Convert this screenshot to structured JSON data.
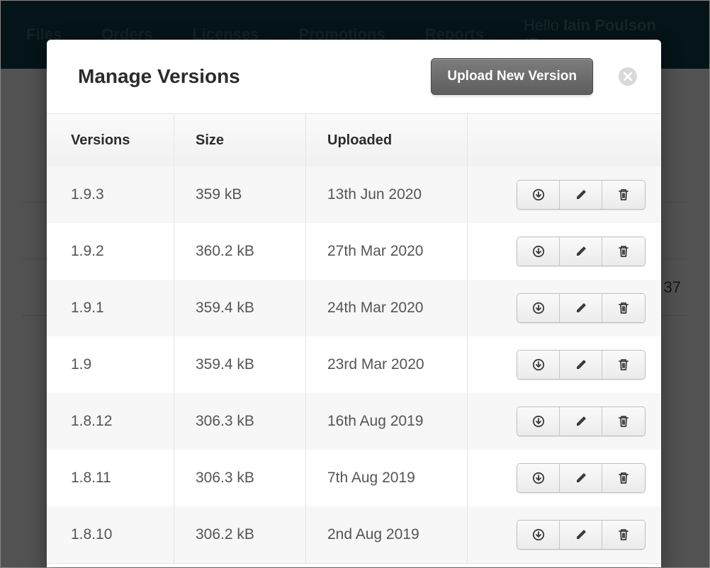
{
  "nav": {
    "items": [
      "Files",
      "Orders",
      "Licenses",
      "Promotions",
      "Reports"
    ],
    "hello_prefix": "Hello",
    "user": "Iain Poulson (Po"
  },
  "bg": {
    "number_right": "37"
  },
  "modal": {
    "title": "Manage Versions",
    "upload_label": "Upload New Version"
  },
  "table": {
    "headers": {
      "versions": "Versions",
      "size": "Size",
      "uploaded": "Uploaded"
    },
    "rows": [
      {
        "version": "1.9.3",
        "size": "359 kB",
        "uploaded": "13th Jun 2020"
      },
      {
        "version": "1.9.2",
        "size": "360.2 kB",
        "uploaded": "27th Mar 2020"
      },
      {
        "version": "1.9.1",
        "size": "359.4 kB",
        "uploaded": "24th Mar 2020"
      },
      {
        "version": "1.9",
        "size": "359.4 kB",
        "uploaded": "23rd Mar 2020"
      },
      {
        "version": "1.8.12",
        "size": "306.3 kB",
        "uploaded": "16th Aug 2019"
      },
      {
        "version": "1.8.11",
        "size": "306.3 kB",
        "uploaded": "7th Aug 2019"
      },
      {
        "version": "1.8.10",
        "size": "306.2 kB",
        "uploaded": "2nd Aug 2019"
      }
    ]
  },
  "icons": {
    "download": "download-icon",
    "edit": "pencil-icon",
    "delete": "trash-icon",
    "close": "close-icon"
  }
}
